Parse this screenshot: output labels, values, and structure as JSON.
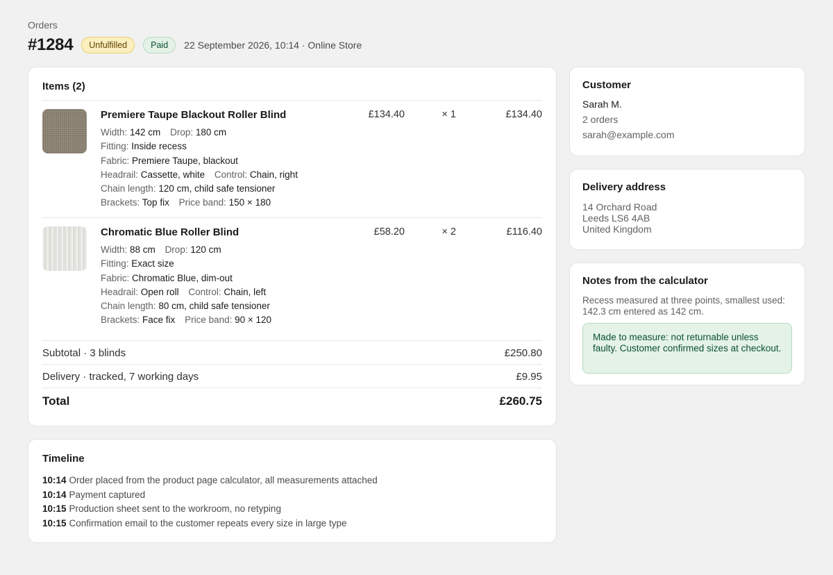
{
  "breadcrumb": "Orders",
  "order": {
    "number": "#1284",
    "fulfillment_badge": "Unfulfilled",
    "payment_badge": "Paid",
    "meta": "22 September 2026, 10:14 · Online Store"
  },
  "items_card": {
    "title": "Items (2)",
    "items": [
      {
        "name": "Premiere Taupe Blackout Roller Blind",
        "unit_price": "£134.40",
        "qty": "× 1",
        "line_total": "£134.40",
        "thumb_color": "#8b8170",
        "specs": {
          "width_label": "Width:",
          "width": "142 cm",
          "drop_label": "Drop:",
          "drop": "180 cm",
          "fitting_label": "Fitting:",
          "fitting": "Inside recess",
          "fabric_label": "Fabric:",
          "fabric": "Premiere Taupe, blackout",
          "headrail_label": "Headrail:",
          "headrail": "Cassette, white",
          "control_label": "Control:",
          "control": "Chain, right",
          "chain_label": "Chain length:",
          "chain": "120 cm, child safe tensioner",
          "brackets_label": "Brackets:",
          "brackets": "Top fix",
          "band_label": "Price band:",
          "band": "150 × 180"
        }
      },
      {
        "name": "Chromatic Blue Roller Blind",
        "unit_price": "£58.20",
        "qty": "× 2",
        "line_total": "£116.40",
        "thumb_color": "#e3e3de",
        "specs": {
          "width_label": "Width:",
          "width": "88 cm",
          "drop_label": "Drop:",
          "drop": "120 cm",
          "fitting_label": "Fitting:",
          "fitting": "Exact size",
          "fabric_label": "Fabric:",
          "fabric": "Chromatic Blue, dim-out",
          "headrail_label": "Headrail:",
          "headrail": "Open roll",
          "control_label": "Control:",
          "control": "Chain, left",
          "chain_label": "Chain length:",
          "chain": "80 cm, child safe tensioner",
          "brackets_label": "Brackets:",
          "brackets": "Face fix",
          "band_label": "Price band:",
          "band": "90 × 120"
        }
      }
    ],
    "subtotal_label": "Subtotal · 3 blinds",
    "subtotal": "£250.80",
    "delivery_label": "Delivery · tracked, 7 working days",
    "delivery": "£9.95",
    "total_label": "Total",
    "total": "£260.75"
  },
  "timeline": {
    "title": "Timeline",
    "events": [
      {
        "time": "10:14",
        "text": "Order placed from the product page calculator, all measurements attached"
      },
      {
        "time": "10:14",
        "text": "Payment captured"
      },
      {
        "time": "10:15",
        "text": "Production sheet sent to the workroom, no retyping"
      },
      {
        "time": "10:15",
        "text": "Confirmation email to the customer repeats every size in large type"
      }
    ]
  },
  "customer": {
    "title": "Customer",
    "name": "Sarah M.",
    "orders": "2 orders",
    "email": "sarah@example.com"
  },
  "delivery_address": {
    "title": "Delivery address",
    "line1": "14 Orchard Road",
    "line2": "Leeds LS6 4AB",
    "line3": "United Kingdom"
  },
  "notes": {
    "title": "Notes from the calculator",
    "text": "Recess measured at three points, smallest used: 142.3 cm entered as 142 cm.",
    "highlight": "Made to measure: not returnable unless faulty. Customer confirmed sizes at checkout."
  },
  "colors": {
    "background": "#f1f1f1",
    "card": "#ffffff",
    "unfulfilled_badge": "#fcefbf",
    "paid_badge": "#e3f1e6",
    "note_box": "#e4f2e7"
  }
}
